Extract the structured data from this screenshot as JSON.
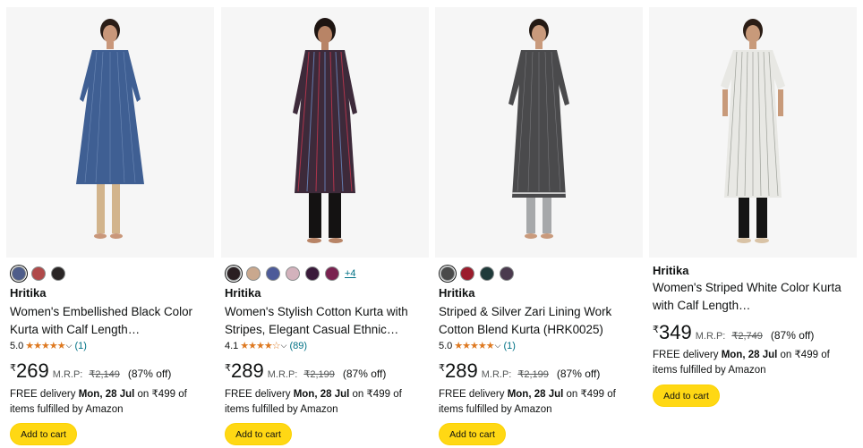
{
  "products": [
    {
      "brand": "Hritika",
      "title": "Women's Embellished Black Color Kurta with Calf Length…",
      "rating": "5.0",
      "stars": "★★★★★",
      "reviews": "(1)",
      "currency": "₹",
      "price": "269",
      "mrp_label": "M.R.P:",
      "mrp": "₹2,149",
      "discount": "(87% off)",
      "delivery_prefix": "FREE delivery ",
      "delivery_date": "Mon, 28 Jul",
      "delivery_suffix": " on ₹499 of items fulfilled by Amazon",
      "cta": "Add to cart",
      "swatches": [
        "#4e5d8a",
        "#b04a4a",
        "#2a2626"
      ],
      "dress_color": "#3f5f93"
    },
    {
      "brand": "Hritika",
      "title": "Women's Stylish Cotton Kurta with Stripes, Elegant Casual Ethnic Wear,…",
      "rating": "4.1",
      "stars": "★★★★☆",
      "reviews": "(89)",
      "currency": "₹",
      "price": "289",
      "mrp_label": "M.R.P:",
      "mrp": "₹2,199",
      "discount": "(87% off)",
      "delivery_prefix": "FREE delivery ",
      "delivery_date": "Mon, 28 Jul",
      "delivery_suffix": " on ₹499 of items fulfilled by Amazon",
      "cta": "Add to cart",
      "swatches": [
        "#2a1f22",
        "#c9a88e",
        "#4d5b99",
        "#d3b2bc",
        "#3a1a3a",
        "#7a2250"
      ],
      "more_colors": "+4",
      "dress_color": "#3d2a3a"
    },
    {
      "brand": "Hritika",
      "title": "Striped & Silver Zari Lining Work Cotton Blend Kurta (HRK0025)",
      "rating": "5.0",
      "stars": "★★★★★",
      "reviews": "(1)",
      "currency": "₹",
      "price": "289",
      "mrp_label": "M.R.P:",
      "mrp": "₹2,199",
      "discount": "(87% off)",
      "delivery_prefix": "FREE delivery ",
      "delivery_date": "Mon, 28 Jul",
      "delivery_suffix": " on ₹499 of items fulfilled by Amazon",
      "cta": "Add to cart",
      "swatches": [
        "#4a4a4a",
        "#9b1c2c",
        "#1f3a3a",
        "#4a3a4e"
      ],
      "dress_color": "#4a4a4c"
    },
    {
      "brand": "Hritika",
      "title": "Women's Striped White Color Kurta with Calf Length…",
      "currency": "₹",
      "price": "349",
      "mrp_label": "M.R.P:",
      "mrp": "₹2,749",
      "discount": "(87% off)",
      "delivery_prefix": "FREE delivery ",
      "delivery_date": "Mon, 28 Jul",
      "delivery_suffix": " on ₹499 of items fulfilled by Amazon",
      "cta": "Add to cart",
      "dress_color": "#e8e8e4"
    }
  ]
}
